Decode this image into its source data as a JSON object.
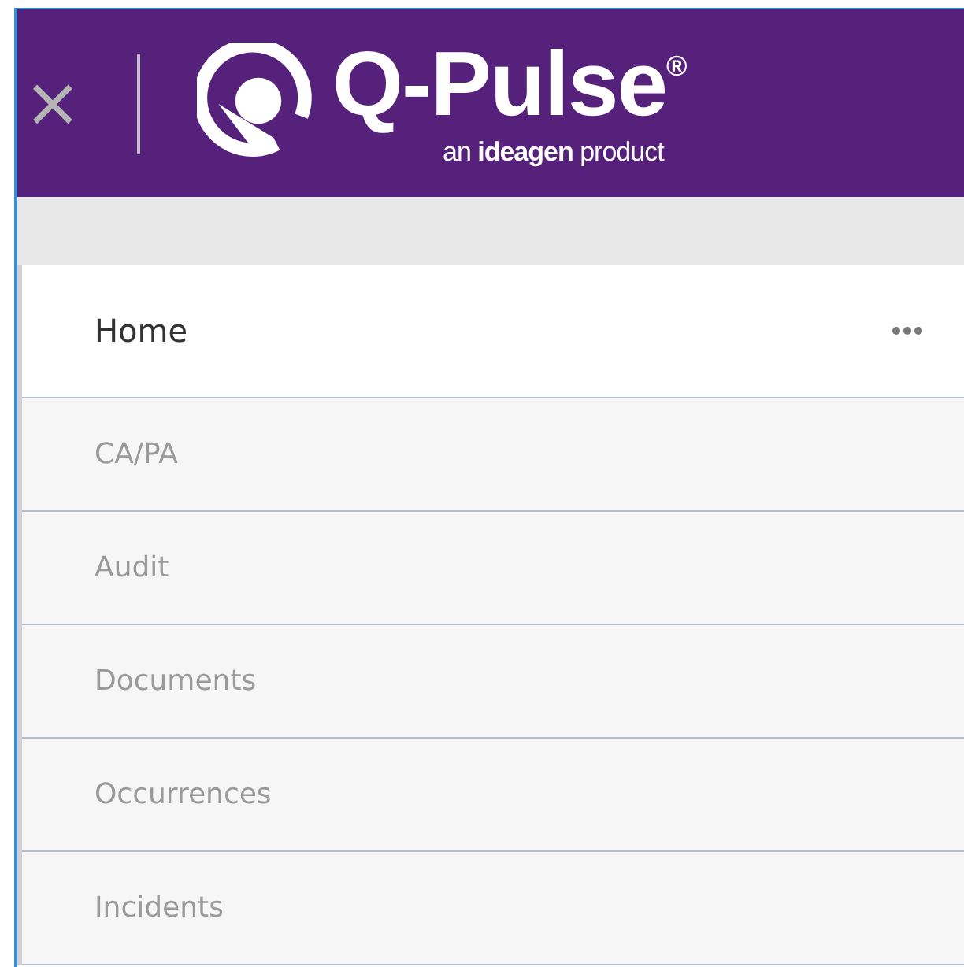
{
  "header": {
    "close": "×",
    "logo": {
      "name": "Q-Pulse$^{®}$",
      "tagline": "an **ideagen** product"
    }
  },
  "nav": {
    "items": [
      {
        "label": "Home",
        "selected": true
      },
      {
        "label": "CA/PA",
        "selected": false
      },
      {
        "label": "Audit",
        "selected": false
      },
      {
        "label": "Documents",
        "selected": false
      },
      {
        "label": "Occurrences",
        "selected": false
      },
      {
        "label": "Incidents",
        "selected": false
      }
    ]
  }
}
